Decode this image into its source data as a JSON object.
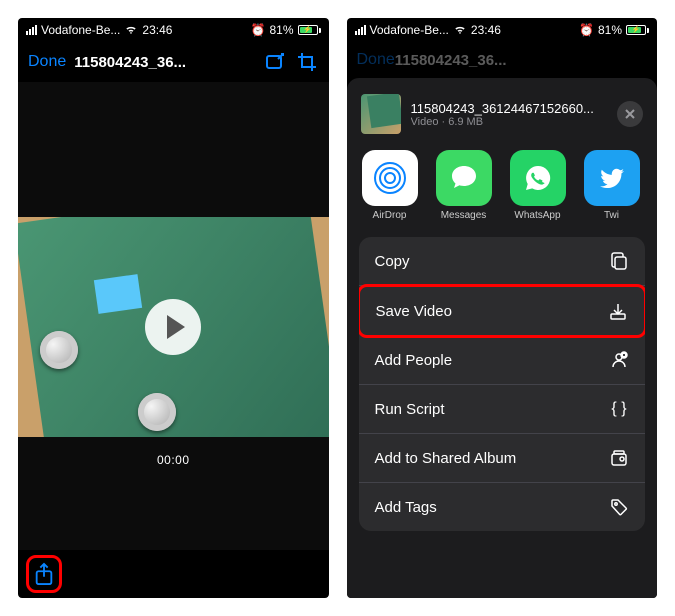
{
  "status": {
    "carrier": "Vodafone-Be...",
    "time": "23:46",
    "battery_pct": "81%"
  },
  "nav": {
    "done": "Done",
    "title": "115804243_36..."
  },
  "video": {
    "time": "00:00"
  },
  "sheet": {
    "title": "115804243_36124467152660...",
    "subtitle": "Video · 6.9 MB",
    "apps": {
      "airdrop": "AirDrop",
      "messages": "Messages",
      "whatsapp": "WhatsApp",
      "twitter": "Twi"
    },
    "actions": {
      "copy": "Copy",
      "save_video": "Save Video",
      "add_people": "Add People",
      "run_script": "Run Script",
      "add_shared": "Add to Shared Album",
      "add_tags": "Add Tags"
    }
  }
}
